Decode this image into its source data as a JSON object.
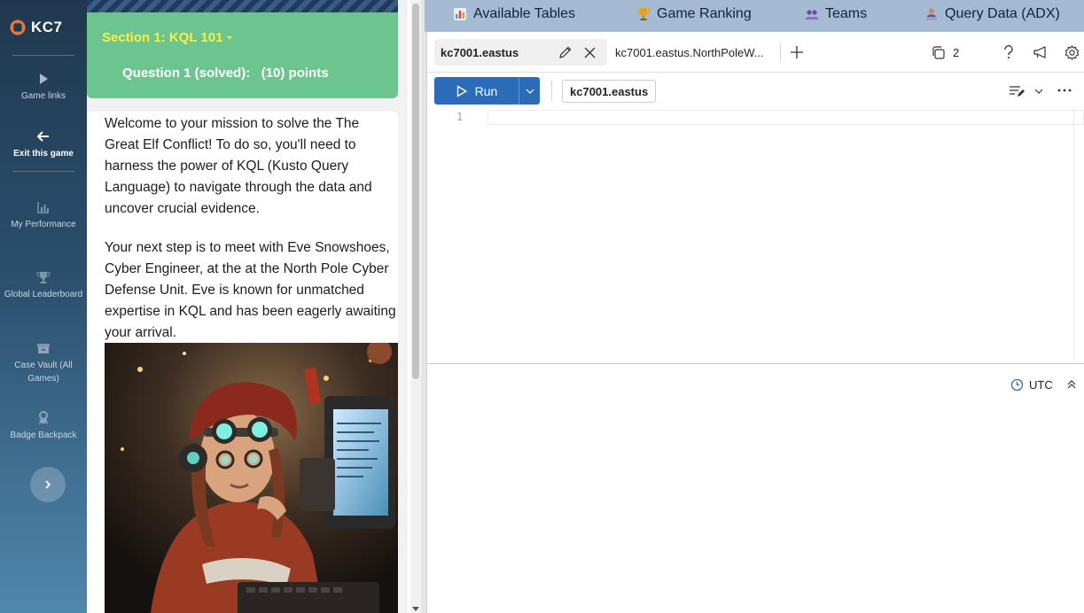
{
  "brand": {
    "logo_text": "KC7"
  },
  "sidebar": {
    "items": [
      {
        "label": "Game links",
        "icon": "play-icon"
      },
      {
        "label": "Exit this game",
        "icon": "arrow-left-icon"
      },
      {
        "label": "My Performance",
        "icon": "bar-chart-icon"
      },
      {
        "label": "Global Leaderboard",
        "icon": "trophy-icon"
      },
      {
        "label": "Case Vault (All Games)",
        "icon": "archive-icon"
      },
      {
        "label": "Badge Backpack",
        "icon": "ribbon-icon"
      }
    ],
    "expand_icon": "chevron-right-icon"
  },
  "mission": {
    "section_title": "Section 1: KQL 101",
    "question_status": "Question 1 (solved):",
    "question_points": "(10) points",
    "paragraph1": "Welcome to your mission to solve the The Great Elf Conflict! To do so, you'll need to harness the power of KQL (Kusto Query Language) to navigate through the data and uncover crucial evidence.",
    "paragraph2": "Your next step is to meet with Eve Snowshoes, Cyber Engineer, at the at the North Pole Cyber Defense Unit. Eve is known for unmatched expertise in KQL and has been eagerly awaiting your arrival."
  },
  "topnav": {
    "items": [
      {
        "label": "Available Tables",
        "icon": "table-chart-icon"
      },
      {
        "label": "Game Ranking",
        "icon": "trophy-icon"
      },
      {
        "label": "Teams",
        "icon": "people-icon"
      },
      {
        "label": "Query Data (ADX)",
        "icon": "user-laptop-icon"
      }
    ]
  },
  "adx": {
    "tabs": [
      {
        "label": "kc7001.eastus",
        "active": true
      },
      {
        "label": "kc7001.eastus.NorthPoleW...",
        "active": false
      }
    ],
    "copies_count": "2",
    "run_label": "Run",
    "database": "kc7001.eastus",
    "editor_line_number": "1",
    "timezone": "UTC"
  },
  "colors": {
    "rail_top": "#20384f",
    "rail_bottom": "#4f87ad",
    "section_green": "#6cc58e",
    "section_title_yellow": "#f7f043",
    "topbar_blue": "#a5bbd4",
    "run_blue": "#2b6cb8"
  }
}
